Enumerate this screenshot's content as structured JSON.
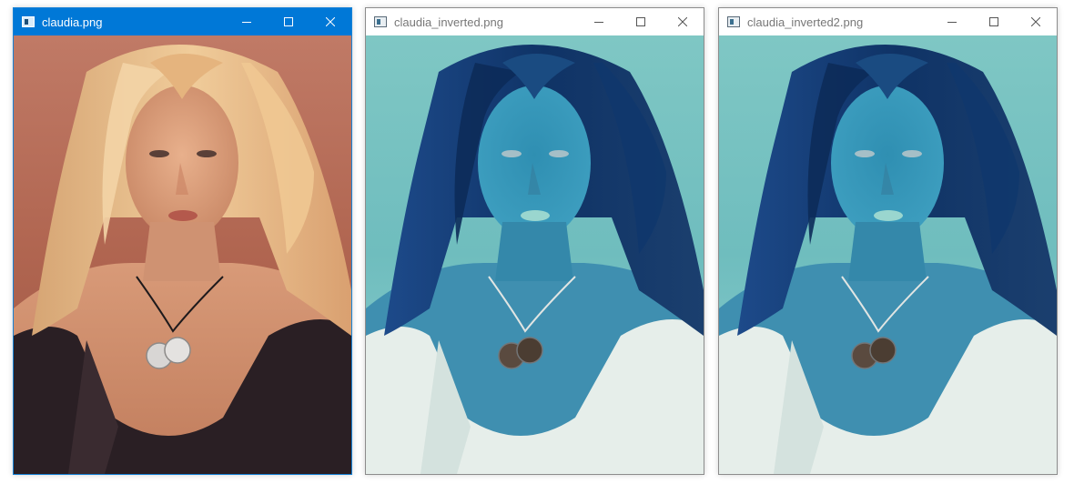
{
  "windows": [
    {
      "title": "claudia.png",
      "active": true,
      "variant": "original"
    },
    {
      "title": "claudia_inverted.png",
      "active": false,
      "variant": "inverted"
    },
    {
      "title": "claudia_inverted2.png",
      "active": false,
      "variant": "inverted"
    }
  ],
  "colors": {
    "active_titlebar": "#0078d7",
    "original_background": "#b26a56",
    "inverted_background": "#76bfc0"
  },
  "icons": {
    "app": "image-app-icon",
    "minimize": "minimize-icon",
    "maximize": "maximize-icon",
    "close": "close-icon"
  }
}
